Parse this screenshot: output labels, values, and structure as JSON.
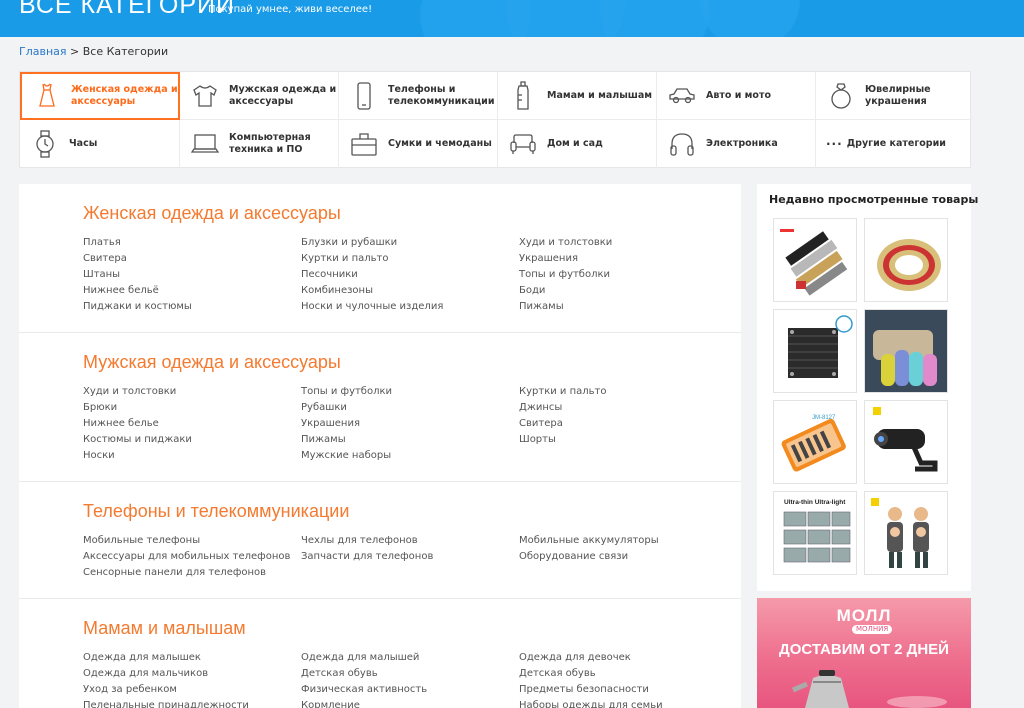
{
  "banner": {
    "title": "ВСЕ КАТЕГОРИИ",
    "slogan": "Покупай умнее, живи веселее!"
  },
  "breadcrumb": {
    "home": "Главная",
    "separator": " > ",
    "current": "Все Категории"
  },
  "colors": {
    "accent": "#f47a2f",
    "banner": "#1a9be8",
    "link": "#2a77c9"
  },
  "categories": [
    {
      "label": "Женская одежда и аксессуары",
      "icon": "dress-icon",
      "active": true
    },
    {
      "label": "Мужская одежда и аксессуары",
      "icon": "tshirt-icon"
    },
    {
      "label": "Телефоны и телекоммуникации",
      "icon": "phone-icon"
    },
    {
      "label": "Мамам и малышам",
      "icon": "baby-bottle-icon"
    },
    {
      "label": "Авто и мото",
      "icon": "car-icon"
    },
    {
      "label": "Ювелирные украшения",
      "icon": "ring-icon"
    },
    {
      "label": "Часы",
      "icon": "watch-icon"
    },
    {
      "label": "Компьютерная техника и ПО",
      "icon": "laptop-icon"
    },
    {
      "label": "Сумки и чемоданы",
      "icon": "bag-icon"
    },
    {
      "label": "Дом и сад",
      "icon": "sofa-icon"
    },
    {
      "label": "Электроника",
      "icon": "headphones-icon"
    },
    {
      "label": "Другие категории",
      "icon": "dots-icon"
    }
  ],
  "sections": [
    {
      "title": "Женская одежда и аксессуары",
      "columns": [
        [
          "Платья",
          "Свитера",
          "Штаны",
          "Нижнее бельё",
          "Пиджаки и костюмы"
        ],
        [
          "Блузки и рубашки",
          "Куртки и пальто",
          "Песочники",
          "Комбинезоны",
          "Носки и чулочные изделия"
        ],
        [
          "Худи и толстовки",
          "Украшения",
          "Топы и футболки",
          "Боди",
          "Пижамы"
        ]
      ]
    },
    {
      "title": "Мужская одежда и аксессуары",
      "columns": [
        [
          "Худи и толстовки",
          "Брюки",
          "Нижнее белье",
          "Костюмы и пиджаки",
          "Носки"
        ],
        [
          "Топы и футболки",
          "Рубашки",
          "Украшения",
          "Пижамы",
          "Мужские наборы"
        ],
        [
          "Куртки и пальто",
          "Джинсы",
          "Свитера",
          "Шорты"
        ]
      ]
    },
    {
      "title": "Телефоны и телекоммуникации",
      "columns": [
        [
          "Мобильные телефоны",
          "Аксессуары для мобильных телефонов",
          "Сенсорные панели для телефонов"
        ],
        [
          "Чехлы для телефонов",
          "Запчасти для телефонов"
        ],
        [
          "Мобильные аккумуляторы",
          "Оборудование связи"
        ]
      ]
    },
    {
      "title": "Мамам и малышам",
      "columns": [
        [
          "Одежда для малышек",
          "Одежда для мальчиков",
          "Уход за ребенком",
          "Пеленальные принадлежности"
        ],
        [
          "Одежда для малышей",
          "Детская обувь",
          "Физическая активность",
          "Кормление"
        ],
        [
          "Одежда для девочек",
          "Детская обувь",
          "Предметы безопасности",
          "Наборы одежды для семьи"
        ]
      ]
    }
  ],
  "sidebar": {
    "title": "Недавно просмотренные товары",
    "thumb_labels": {
      "solder": "JM-8127",
      "heatsink": "Ultra-thin Ultra-light"
    }
  },
  "promo": {
    "logo": "МОЛЛ",
    "sub": "МОЛНИЯ",
    "text": "ДОСТАВИМ ОТ 2 ДНЕЙ"
  }
}
